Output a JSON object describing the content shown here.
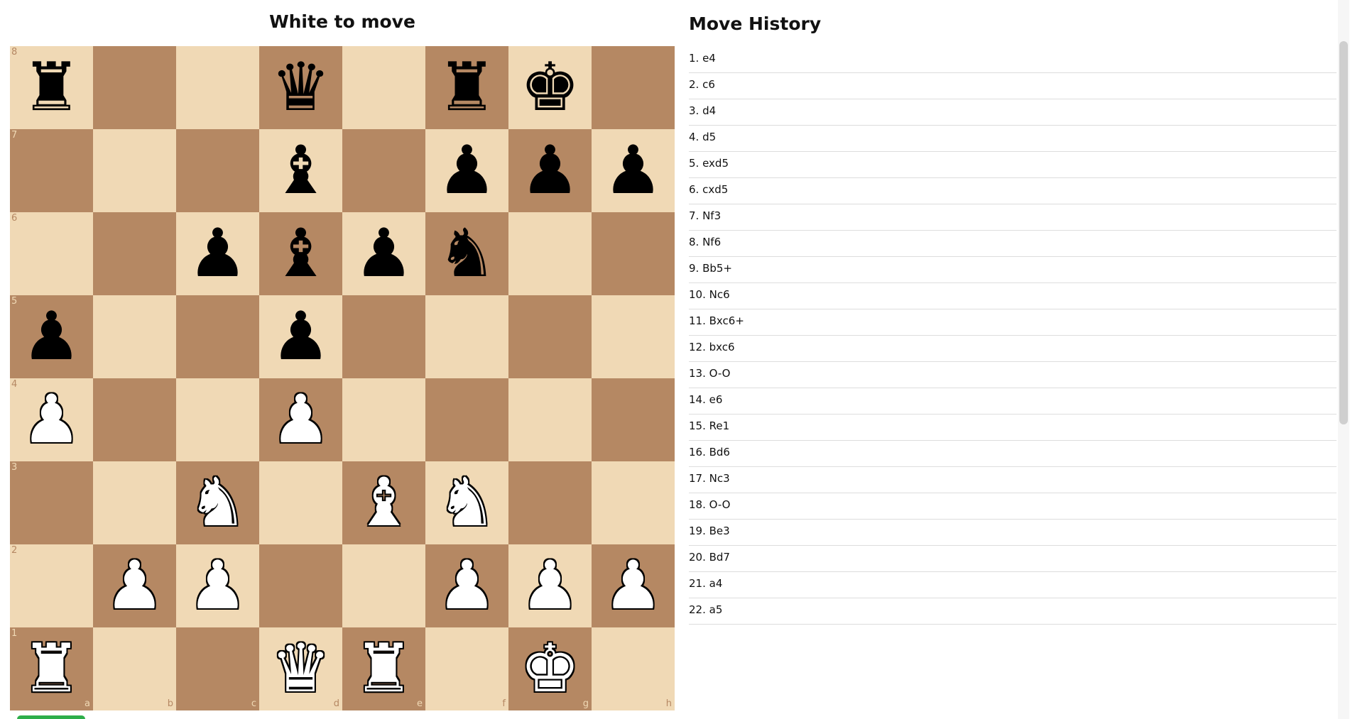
{
  "status": "White to move",
  "history_title": "Move History",
  "files": [
    "a",
    "b",
    "c",
    "d",
    "e",
    "f",
    "g",
    "h"
  ],
  "ranks": [
    "8",
    "7",
    "6",
    "5",
    "4",
    "3",
    "2",
    "1"
  ],
  "board": [
    [
      "r",
      "",
      "",
      "q",
      "",
      "r",
      "k",
      ""
    ],
    [
      "",
      "",
      "",
      "b",
      "",
      "p",
      "p",
      "p"
    ],
    [
      "",
      "",
      "p",
      "b",
      "p",
      "n",
      "",
      ""
    ],
    [
      "p",
      "",
      "",
      "p",
      "",
      "",
      "",
      ""
    ],
    [
      "P",
      "",
      "",
      "P",
      "",
      "",
      "",
      ""
    ],
    [
      "",
      "",
      "N",
      "",
      "B",
      "N",
      "",
      ""
    ],
    [
      "",
      "P",
      "P",
      "",
      "",
      "P",
      "P",
      "P"
    ],
    [
      "R",
      "",
      "",
      "Q",
      "R",
      "",
      "K",
      ""
    ]
  ],
  "piece_icons": {
    "k": "king-icon",
    "q": "queen-icon",
    "r": "rook-icon",
    "b": "bishop-icon",
    "n": "knight-icon",
    "p": "pawn-icon"
  },
  "colors": {
    "light_square": "#f0d9b5",
    "dark_square": "#b58863",
    "accent_button": "#2eae4a"
  },
  "moves": [
    "1. e4",
    "2. c6",
    "3. d4",
    "4. d5",
    "5. exd5",
    "6. cxd5",
    "7. Nf3",
    "8. Nf6",
    "9. Bb5+",
    "10. Nc6",
    "11. Bxc6+",
    "12. bxc6",
    "13. O-O",
    "14. e6",
    "15. Re1",
    "16. Bd6",
    "17. Nc3",
    "18. O-O",
    "19. Be3",
    "20. Bd7",
    "21. a4",
    "22. a5"
  ]
}
